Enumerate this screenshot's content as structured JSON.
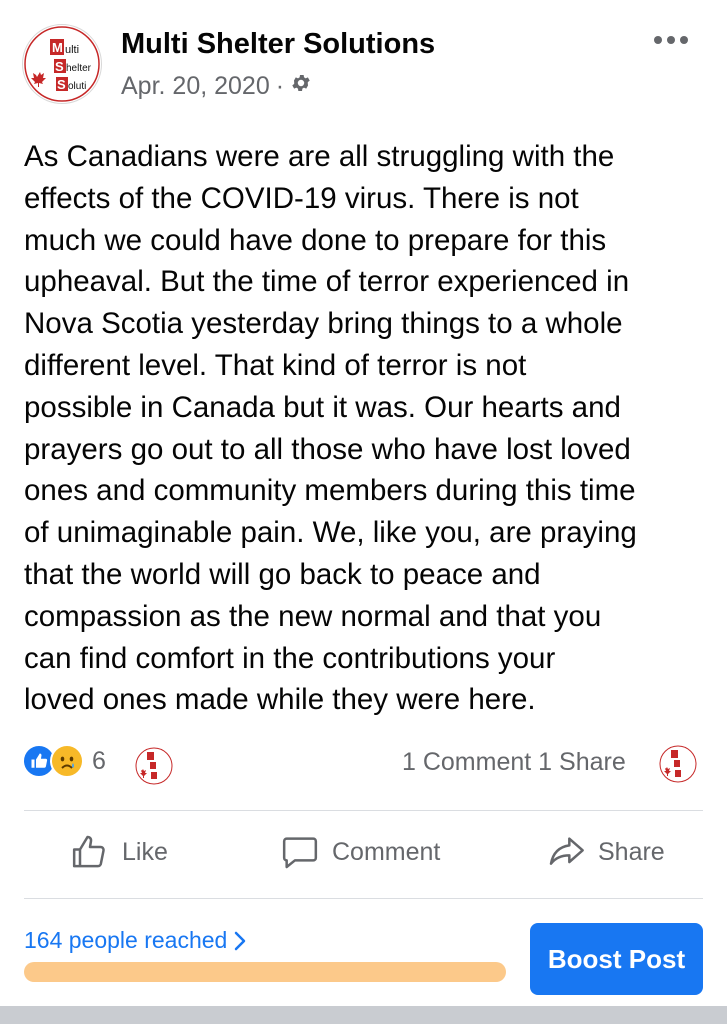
{
  "post": {
    "page_name": "Multi Shelter Solutions",
    "date": "Apr. 20, 2020",
    "separator": "·",
    "privacy_icon": "gear-icon",
    "more_icon": "more-options-icon",
    "avatar": {
      "lines": [
        "M",
        "ulti",
        "S",
        "helter",
        "S",
        "oluti"
      ]
    },
    "text": "As Canadians were are all struggling with the\neffects of the COVID-19 virus. There is not\nmuch we could have done to prepare for this\nupheaval. But the time of terror experienced in\nNova Scotia yesterday bring things to a whole\ndifferent level. That kind of terror is not\npossible in Canada but it was. Our hearts and\nprayers go out to all those who have lost loved\nones and community members during this time\nof unimaginable pain. We, like you, are praying\nthat the world will go back to peace and\ncompassion as the new normal and that you\ncan find comfort in the contributions your\nloved ones made while they were here."
  },
  "engagement": {
    "reaction_icons": [
      "like-icon",
      "sad-icon"
    ],
    "reaction_count": "6",
    "comments": "1 Comment",
    "shares": "1 Share"
  },
  "actions": {
    "like_label": "Like",
    "comment_label": "Comment",
    "share_label": "Share"
  },
  "promotion": {
    "reach_text": "164 people reached",
    "reach_progress": 1.0,
    "boost_label": "Boost Post"
  },
  "colors": {
    "accent": "#1877f2",
    "progress_fill": "#fcc98a",
    "muted_text": "#65676b",
    "logo_red": "#c62828"
  }
}
